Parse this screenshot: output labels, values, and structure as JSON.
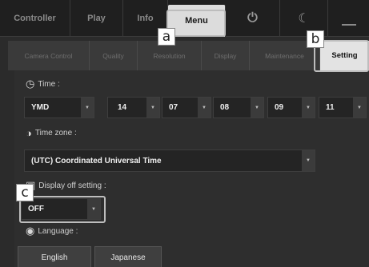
{
  "top_tabs": {
    "controller": "Controller",
    "play": "Play",
    "info": "Info",
    "menu": "Menu"
  },
  "sub_tabs": {
    "camera_control": "Camera Control",
    "quality": "Quality",
    "resolution": "Resolution",
    "display": "Display",
    "maintenance": "Maintenance",
    "setting": "Setting"
  },
  "time": {
    "label": "Time :",
    "format": "YMD",
    "fields": [
      "14",
      "07",
      "08",
      "09",
      "11"
    ]
  },
  "timezone": {
    "label": "Time zone :",
    "value": "(UTC) Coordinated Universal Time"
  },
  "display_off": {
    "label": "Display off setting :",
    "value": "OFF"
  },
  "language": {
    "label": "Language :",
    "buttons": [
      "English",
      "Japanese"
    ]
  },
  "callouts": {
    "a": "a",
    "b": "b",
    "c": "c"
  },
  "icons": {
    "power": "power-icon",
    "moon": "moon-icon",
    "minimize": "minimize-icon",
    "time": "clock-gear-icon",
    "timezone": "globe-clock-icon",
    "display": "monitor-icon",
    "language": "speech-globe-icon"
  }
}
